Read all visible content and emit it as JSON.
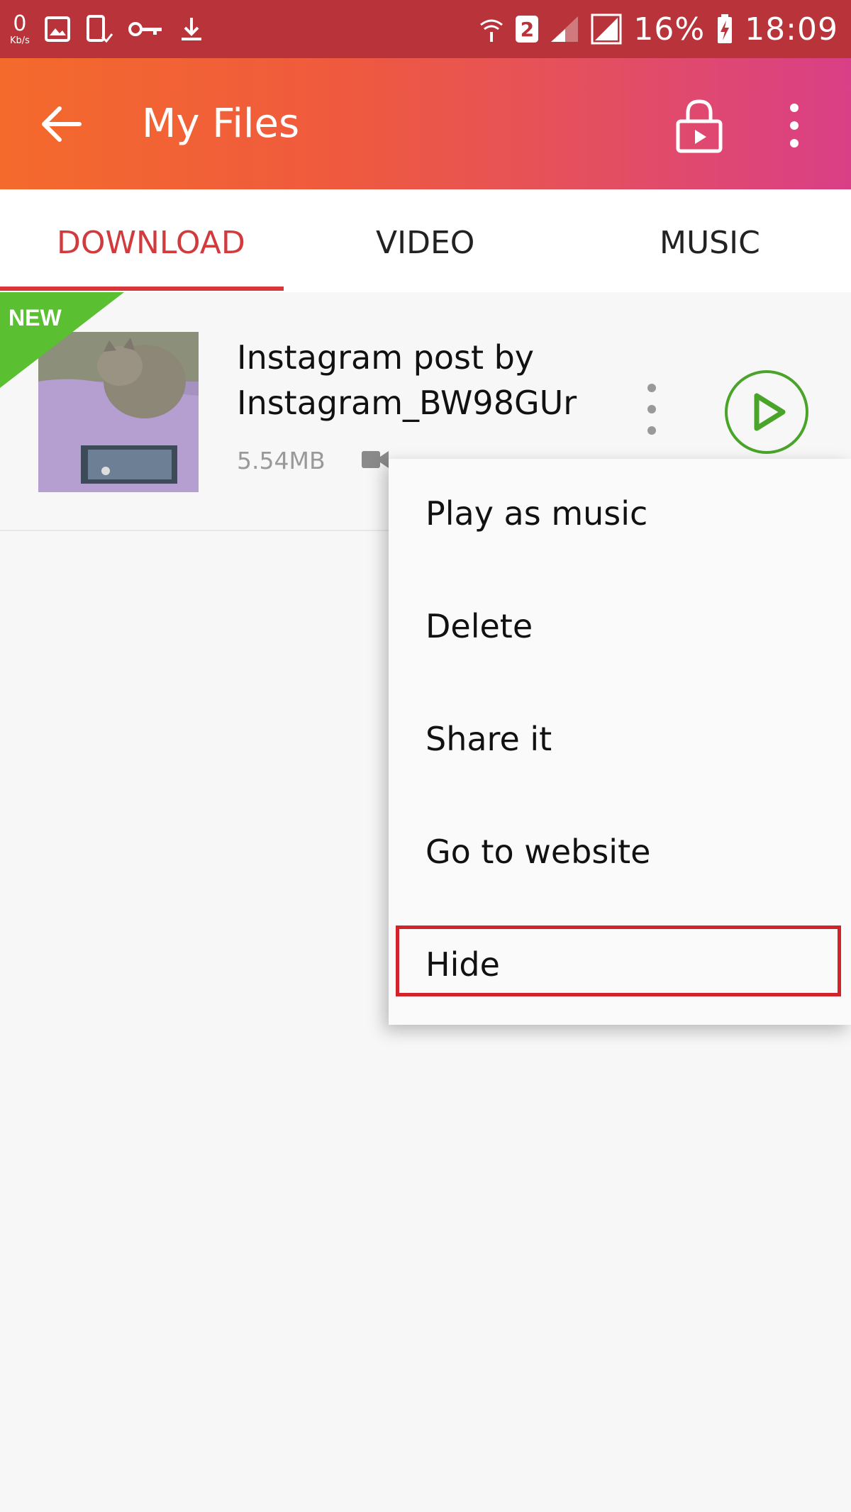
{
  "status_bar": {
    "net_speed_value": "0",
    "net_speed_unit": "Kb/s",
    "sim": "2",
    "battery": "16%",
    "time": "18:09"
  },
  "appbar": {
    "title": "My Files"
  },
  "tabs": [
    {
      "label": "DOWNLOAD",
      "active": true
    },
    {
      "label": "VIDEO",
      "active": false
    },
    {
      "label": "MUSIC",
      "active": false
    }
  ],
  "file_item": {
    "badge": "NEW",
    "title_line1": "Instagram post by",
    "title_line2": "Instagram_BW98GUr",
    "size": "5.54MB"
  },
  "context_menu": {
    "items": [
      {
        "label": "Play as music"
      },
      {
        "label": "Delete"
      },
      {
        "label": "Share it"
      },
      {
        "label": "Go to website"
      },
      {
        "label": "Hide",
        "highlighted": true
      }
    ]
  },
  "colors": {
    "status_bar": "#b8343a",
    "appbar_start": "#f46a2c",
    "appbar_end": "#d93f86",
    "tab_active": "#d13b3e",
    "new_badge": "#5bbf32",
    "play_button": "#4aa42a",
    "highlight_box": "#d2232a"
  }
}
